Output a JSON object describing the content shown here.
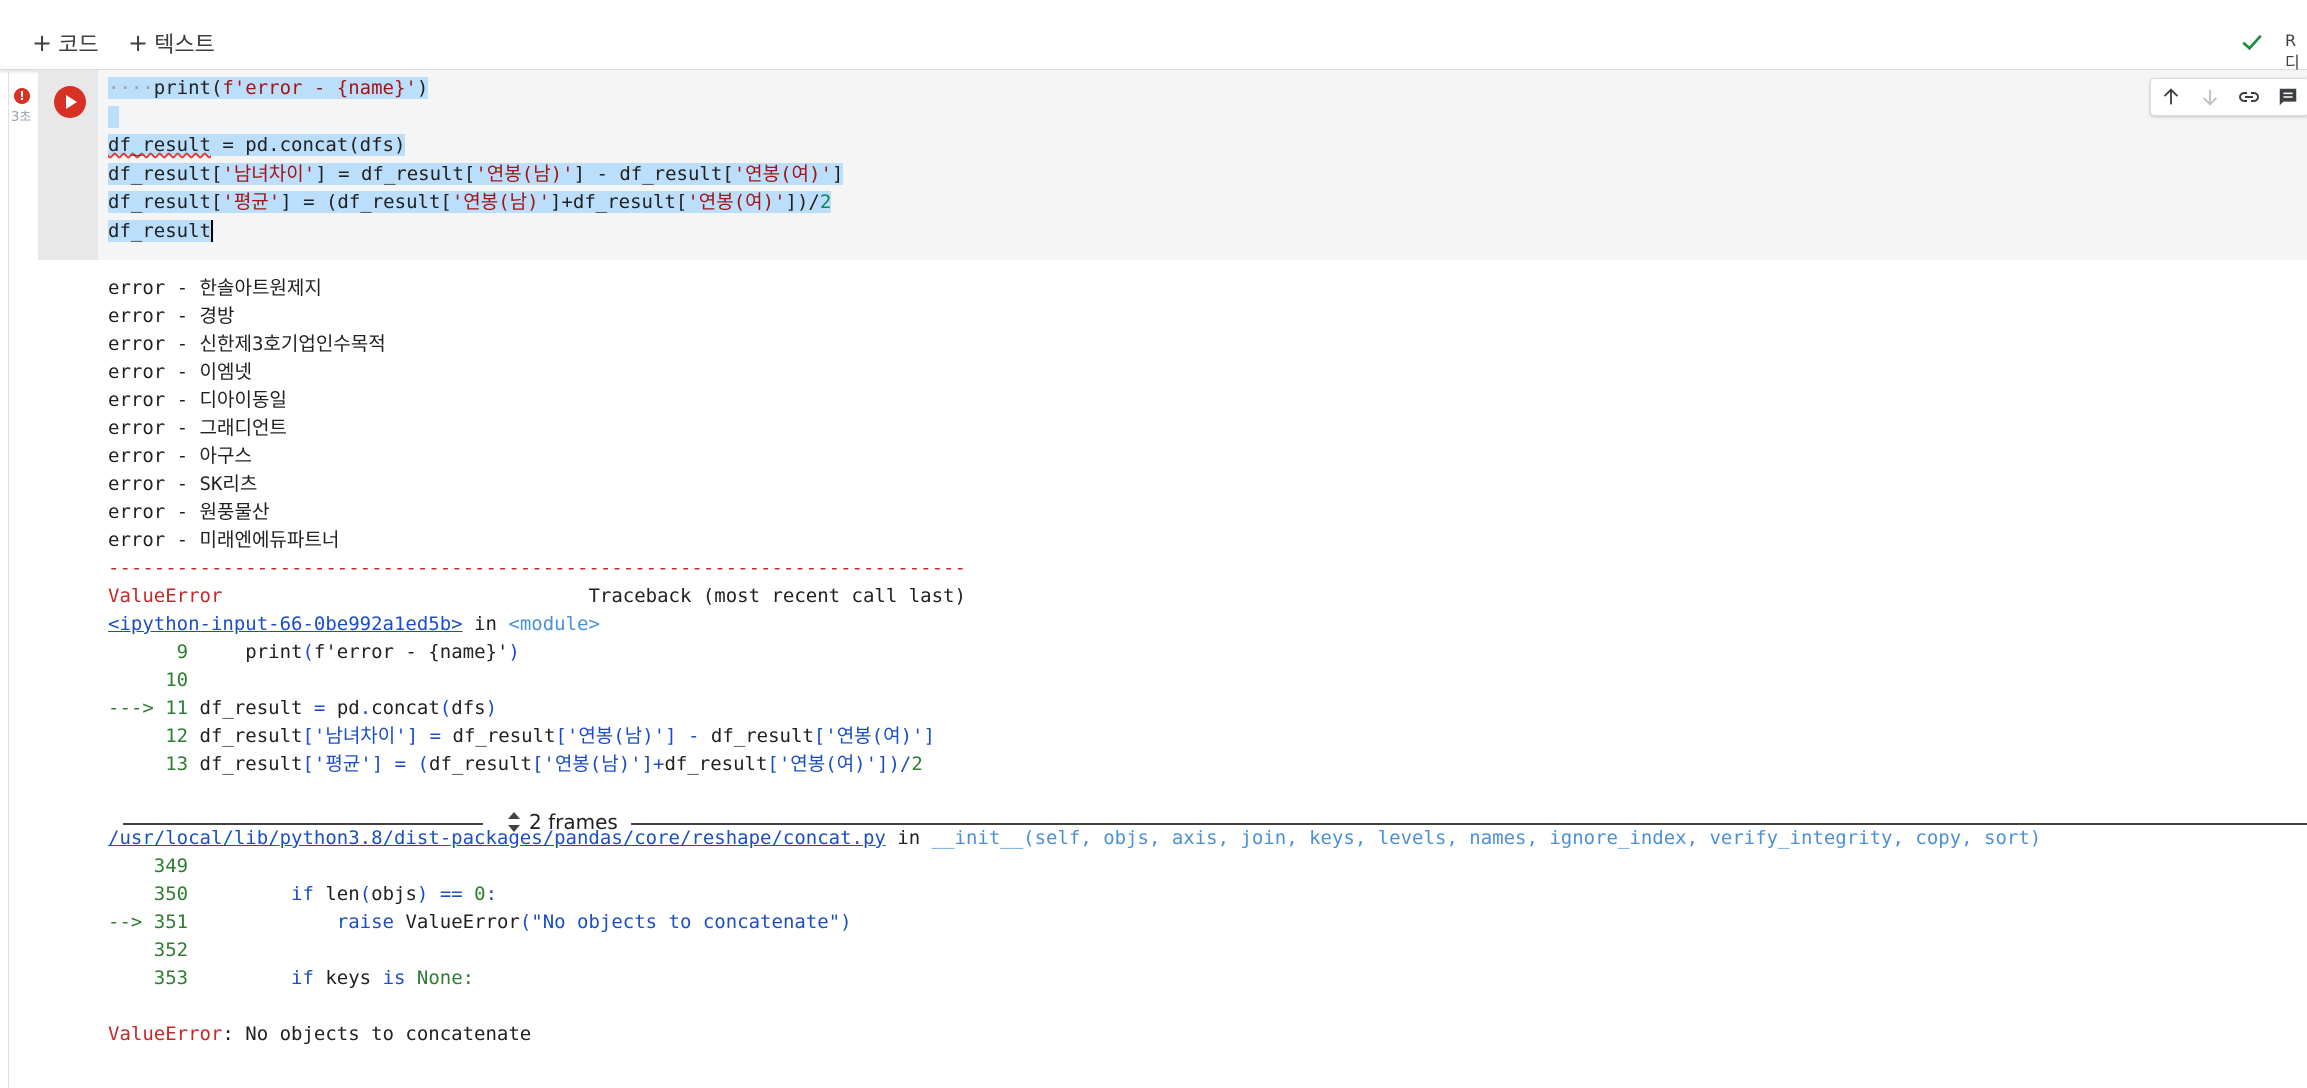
{
  "toolbar": {
    "add_code_label": "코드",
    "add_text_label": "텍스트"
  },
  "status": {
    "line1": "R",
    "line2": "디"
  },
  "cell": {
    "exec_time": "3초",
    "code_lines": [
      {
        "id": "l1",
        "html": "<span class=\"dots\">····</span>print(<span class=\"str\">f'error - {name}'</span>)"
      },
      {
        "id": "l2",
        "html": ""
      },
      {
        "id": "l3",
        "html": "<span class=\"squig\">df_result</span> = pd.concat(dfs)"
      },
      {
        "id": "l4",
        "html": "df_result[<span class=\"str\">'남녀차이'</span>] = df_result[<span class=\"str\">'연봉(남)'</span>] - df_result[<span class=\"str\">'연봉(여)'</span>]"
      },
      {
        "id": "l5",
        "html": "df_result[<span class=\"str\">'평균'</span>] = (df_result[<span class=\"str\">'연봉(남)'</span>]+df_result[<span class=\"str\">'연봉(여)'</span>])/<span class=\"num\">2</span>"
      },
      {
        "id": "l6",
        "html": "df_result<span class=\"cursor\"></span>"
      }
    ]
  },
  "output": {
    "error_lines": [
      "error - 한솔아트원제지",
      "error - 경방",
      "error - 신한제3호기업인수목적",
      "error - 이엠넷",
      "error - 디아이동일",
      "error - 그래디언트",
      "error - 아구스",
      "error - SK리츠",
      "error - 원풍물산",
      "error - 미래엔에듀파트너"
    ],
    "separator": "---------------------------------------------------------------------------",
    "traceback_lines": [
      "<span class=\"red\">ValueError</span>                                Traceback (most recent call last)",
      "<span class=\"lnk\">&lt;ipython-input-66-0be992a1ed5b&gt;</span> in <span class=\"mod\">&lt;module&gt;</span>",
      "<span class=\"green\">      9</span>     print<span class=\"blue\">(</span>f'error - {name}'<span class=\"blue\">)</span>",
      "<span class=\"green\">     10</span> ",
      "<span class=\"green\">---&gt; 11</span> df_result <span class=\"blue\">=</span> pd<span class=\"blue\">.</span>concat<span class=\"blue\">(</span>dfs<span class=\"blue\">)</span>",
      "<span class=\"green\">     12</span> df_result<span class=\"blue\">['남녀차이']</span> <span class=\"blue\">=</span> df_result<span class=\"blue\">['연봉(남)']</span> <span class=\"blue\">-</span> df_result<span class=\"blue\">['연봉(여)']</span>",
      "<span class=\"green\">     13</span> df_result<span class=\"blue\">['평균']</span> <span class=\"blue\">=</span> <span class=\"blue\">(</span>df_result<span class=\"blue\">['연봉(남)']+</span>df_result<span class=\"blue\">['연봉(여)'])/</span><span class=\"green\">2</span>"
    ],
    "frames_label": "2 frames",
    "traceback2_lines": [
      "<span class=\"lnk\">/usr/local/lib/python3.8/dist-packages/pandas/core/reshape/concat.py</span> in <span class=\"mod\">__init__(self, objs, axis, join, keys, levels, names, ignore_index, verify_integrity, copy, sort)</span>",
      "<span class=\"green\">    349</span> ",
      "<span class=\"green\">    350</span>         <span class=\"blue\">if</span> len<span class=\"blue\">(</span>objs<span class=\"blue\">)</span> <span class=\"blue\">==</span> <span class=\"green\">0</span><span class=\"blue\">:</span>",
      "<span class=\"green\">--&gt; 351</span>             <span class=\"blue\">raise</span> ValueError<span class=\"blue\">(\"No objects to concatenate\")</span>",
      "<span class=\"green\">    352</span> ",
      "<span class=\"green\">    353</span>         <span class=\"blue\">if</span> keys <span class=\"blue\">is</span> <span class=\"green\">None:</span>",
      "",
      "<span class=\"red\">ValueError</span>: No objects to concatenate"
    ]
  }
}
